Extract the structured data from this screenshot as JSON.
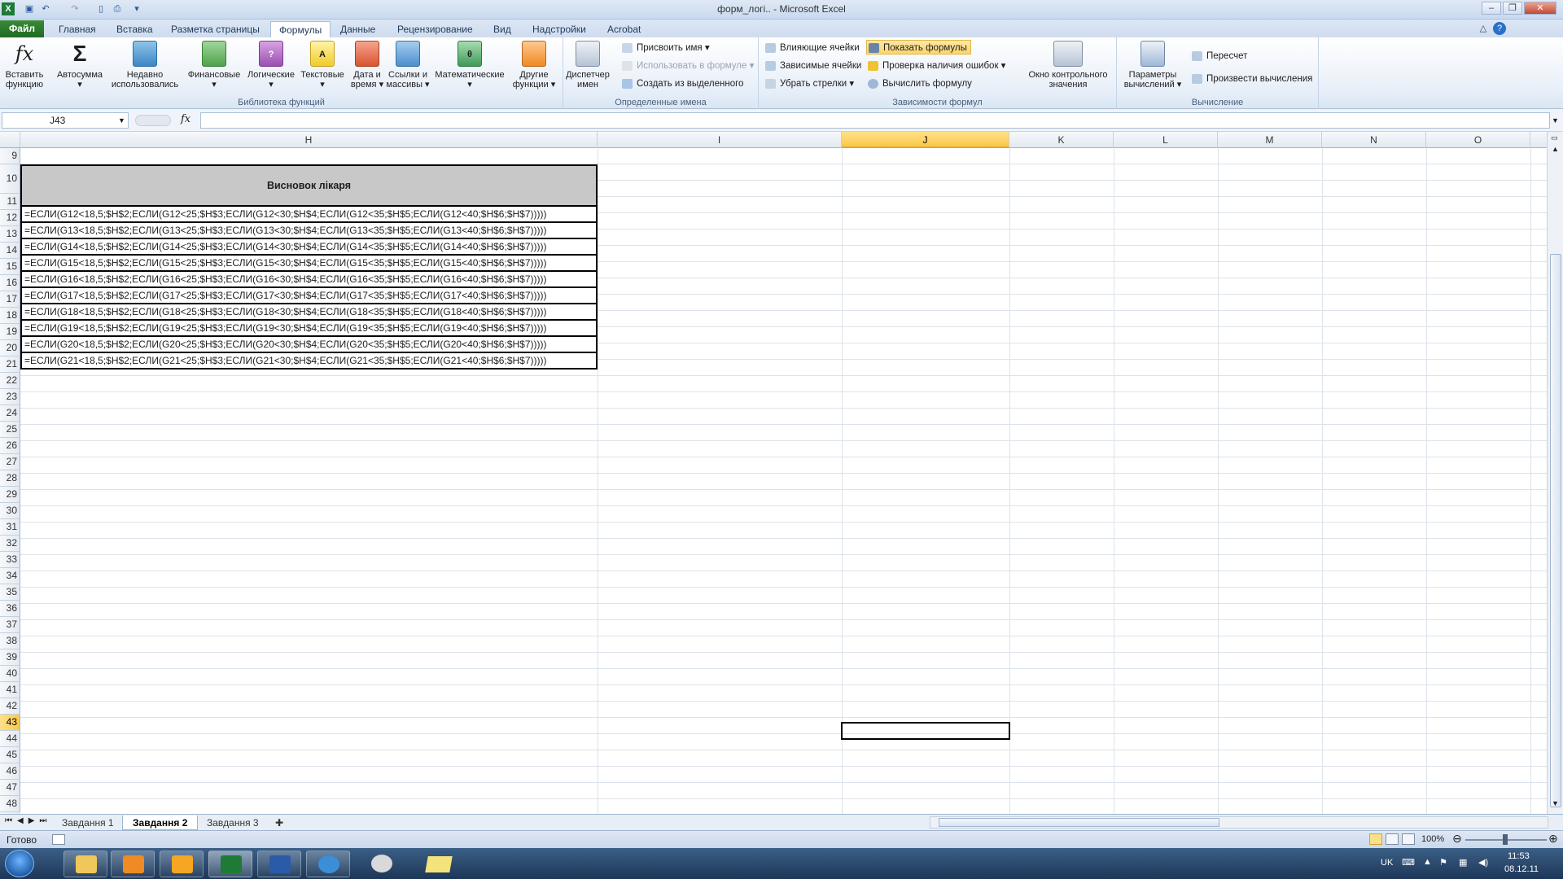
{
  "window": {
    "title": "форм_логі.. - Microsoft Excel"
  },
  "tabs": [
    "Файл",
    "Главная",
    "Вставка",
    "Разметка страницы",
    "Формулы",
    "Данные",
    "Рецензирование",
    "Вид",
    "Надстройки",
    "Acrobat"
  ],
  "ribbon": {
    "lib": {
      "insert_fn": "Вставить функцию",
      "autosum": "Автосумма",
      "recent": "Недавно использовались",
      "financial": "Финансовые",
      "logical": "Логические",
      "text": "Текстовые",
      "datetime": "Дата и время",
      "lookup": "Ссылки и массивы",
      "math": "Математические",
      "other": "Другие функции",
      "group": "Библиотека функций"
    },
    "names": {
      "manager": "Диспетчер имен",
      "assign": "Присвоить имя",
      "use_in_formula": "Использовать в формуле",
      "create": "Создать из выделенного",
      "group": "Определенные имена"
    },
    "deps": {
      "precedents": "Влияющие ячейки",
      "dependents": "Зависимые ячейки",
      "remove_arrows": "Убрать стрелки",
      "show_formulas": "Показать формулы",
      "error_check": "Проверка наличия ошибок",
      "evaluate": "Вычислить формулу",
      "watch": "Окно контрольного значения",
      "group": "Зависимости формул"
    },
    "calc": {
      "options": "Параметры вычислений",
      "calc_now": "Пересчет",
      "calc_sheet": "Произвести вычисления",
      "group": "Вычисление"
    }
  },
  "formula_bar": {
    "name_box": "J43",
    "fx": "fx"
  },
  "columns": [
    "H",
    "I",
    "J",
    "K",
    "L",
    "M",
    "N",
    "O"
  ],
  "rows": [
    "9",
    "10",
    "11",
    "12",
    "13",
    "14",
    "15",
    "16",
    "17",
    "18",
    "19",
    "20",
    "21",
    "22",
    "23",
    "24",
    "25",
    "26",
    "27",
    "28",
    "29",
    "30",
    "31",
    "32",
    "33",
    "34",
    "35",
    "36",
    "37",
    "38",
    "39",
    "40",
    "41",
    "42",
    "43",
    "44",
    "45",
    "46",
    "47",
    "48"
  ],
  "header_cell": "Висновок лікаря",
  "formulas": [
    "=ЕСЛИ(G12<18,5;$H$2;ЕСЛИ(G12<25;$H$3;ЕСЛИ(G12<30;$H$4;ЕСЛИ(G12<35;$H$5;ЕСЛИ(G12<40;$H$6;$H$7)))))",
    "=ЕСЛИ(G13<18,5;$H$2;ЕСЛИ(G13<25;$H$3;ЕСЛИ(G13<30;$H$4;ЕСЛИ(G13<35;$H$5;ЕСЛИ(G13<40;$H$6;$H$7)))))",
    "=ЕСЛИ(G14<18,5;$H$2;ЕСЛИ(G14<25;$H$3;ЕСЛИ(G14<30;$H$4;ЕСЛИ(G14<35;$H$5;ЕСЛИ(G14<40;$H$6;$H$7)))))",
    "=ЕСЛИ(G15<18,5;$H$2;ЕСЛИ(G15<25;$H$3;ЕСЛИ(G15<30;$H$4;ЕСЛИ(G15<35;$H$5;ЕСЛИ(G15<40;$H$6;$H$7)))))",
    "=ЕСЛИ(G16<18,5;$H$2;ЕСЛИ(G16<25;$H$3;ЕСЛИ(G16<30;$H$4;ЕСЛИ(G16<35;$H$5;ЕСЛИ(G16<40;$H$6;$H$7)))))",
    "=ЕСЛИ(G17<18,5;$H$2;ЕСЛИ(G17<25;$H$3;ЕСЛИ(G17<30;$H$4;ЕСЛИ(G17<35;$H$5;ЕСЛИ(G17<40;$H$6;$H$7)))))",
    "=ЕСЛИ(G18<18,5;$H$2;ЕСЛИ(G18<25;$H$3;ЕСЛИ(G18<30;$H$4;ЕСЛИ(G18<35;$H$5;ЕСЛИ(G18<40;$H$6;$H$7)))))",
    "=ЕСЛИ(G19<18,5;$H$2;ЕСЛИ(G19<25;$H$3;ЕСЛИ(G19<30;$H$4;ЕСЛИ(G19<35;$H$5;ЕСЛИ(G19<40;$H$6;$H$7)))))",
    "=ЕСЛИ(G20<18,5;$H$2;ЕСЛИ(G20<25;$H$3;ЕСЛИ(G20<30;$H$4;ЕСЛИ(G20<35;$H$5;ЕСЛИ(G20<40;$H$6;$H$7)))))",
    "=ЕСЛИ(G21<18,5;$H$2;ЕСЛИ(G21<25;$H$3;ЕСЛИ(G21<30;$H$4;ЕСЛИ(G21<35;$H$5;ЕСЛИ(G21<40;$H$6;$H$7)))))"
  ],
  "sheets": [
    "Завдання 1",
    "Завдання 2",
    "Завдання 3"
  ],
  "status": {
    "ready": "Готово",
    "zoom": "100%"
  },
  "tray": {
    "lang": "UK",
    "time": "11:53",
    "date": "08.12.11"
  }
}
